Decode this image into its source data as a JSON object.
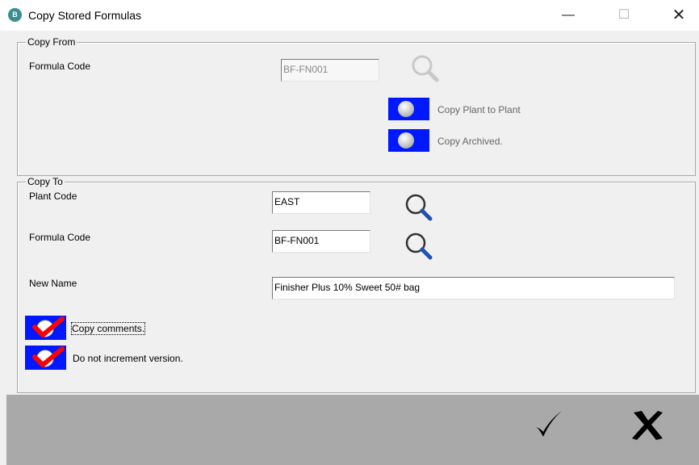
{
  "window": {
    "title": "Copy Stored Formulas",
    "app_icon_text": "B",
    "minimize_glyph": "—",
    "maximize_glyph": "☐",
    "close_glyph": "✕"
  },
  "copy_from": {
    "legend": "Copy From",
    "formula_code_label": "Formula Code",
    "formula_code_value": "BF-FN001",
    "options": [
      {
        "label": "Copy Plant to Plant",
        "selected": false
      },
      {
        "label": "Copy Archived.",
        "selected": false
      }
    ]
  },
  "copy_to": {
    "legend": "Copy To",
    "plant_code_label": "Plant Code",
    "plant_code_value": "EAST",
    "formula_code_label": "Formula Code",
    "formula_code_value": "BF-FN001",
    "new_name_label": "New Name",
    "new_name_value": "Finisher Plus 10% Sweet 50# bag",
    "checkboxes": [
      {
        "label": "Copy comments.",
        "checked": true
      },
      {
        "label": "Do not increment version.",
        "checked": true
      }
    ]
  },
  "footer": {
    "ok_icon": "checkmark-icon",
    "cancel_icon": "x-icon"
  },
  "colors": {
    "option_blue": "#0018ff",
    "check_red": "#ff0000",
    "footer_gray": "#a9a9a9"
  }
}
